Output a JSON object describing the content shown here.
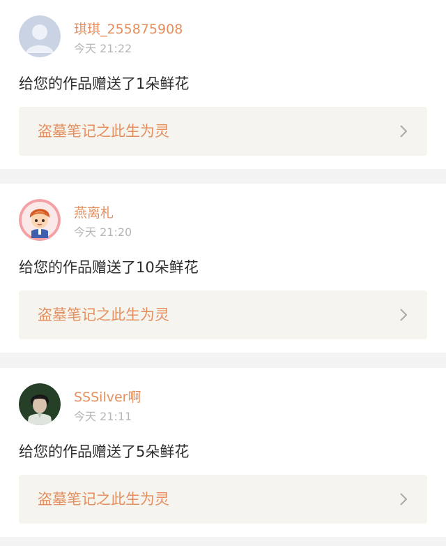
{
  "notifications": [
    {
      "username": "琪琪_255875908",
      "timestamp": "今天 21:22",
      "message": "给您的作品赠送了1朵鲜花",
      "book_title": "盗墓笔记之此生为灵",
      "avatar_icon": "default-user-avatar"
    },
    {
      "username": "燕离札",
      "timestamp": "今天 21:20",
      "message": "给您的作品赠送了10朵鲜花",
      "book_title": "盗墓笔记之此生为灵",
      "avatar_icon": "cartoon-boy-avatar"
    },
    {
      "username": "SSSilver啊",
      "timestamp": "今天 21:11",
      "message": "给您的作品赠送了5朵鲜花",
      "book_title": "盗墓笔记之此生为灵",
      "avatar_icon": "photo-avatar"
    }
  ],
  "colors": {
    "username": "#e58f5f",
    "book_title": "#e58f5f",
    "timestamp": "#b5b5b5",
    "message": "#2b2b2b",
    "link_background": "#f5f4ee",
    "divider": "#f3f3f3"
  }
}
